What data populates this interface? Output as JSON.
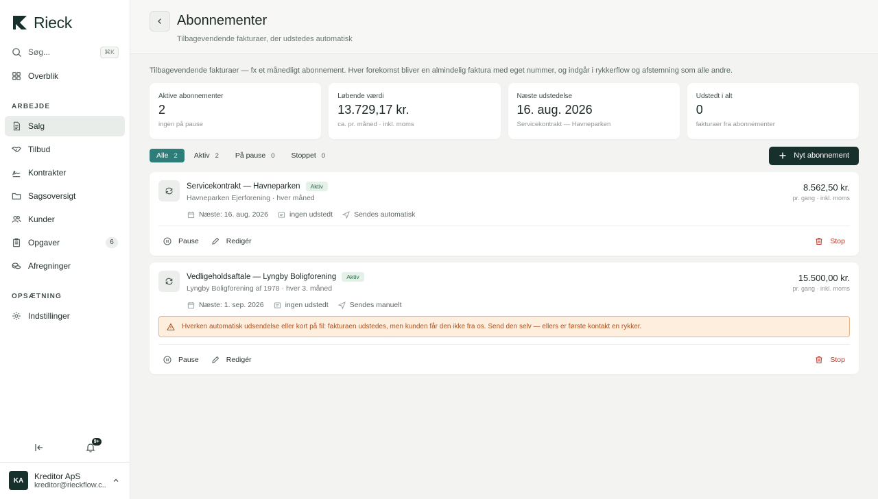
{
  "brand": {
    "name": "Rieck"
  },
  "search": {
    "placeholder": "Søg...",
    "shortcut": "⌘K"
  },
  "nav": {
    "overview": "Overblik",
    "section_work": "ARBEJDE",
    "work_items": [
      {
        "label": "Salg",
        "icon": "document-icon",
        "active": true
      },
      {
        "label": "Tilbud",
        "icon": "handshake-icon"
      },
      {
        "label": "Kontrakter",
        "icon": "signature-icon"
      },
      {
        "label": "Sagsoversigt",
        "icon": "folder-icon"
      },
      {
        "label": "Kunder",
        "icon": "users-icon"
      },
      {
        "label": "Opgaver",
        "icon": "clipboard-icon",
        "badge": "6"
      },
      {
        "label": "Afregninger",
        "icon": "coins-icon"
      }
    ],
    "section_setup": "OPSÆTNING",
    "settings": "Indstillinger"
  },
  "tools": {
    "notif_badge": "9+"
  },
  "account": {
    "initials": "KA",
    "name": "Kreditor ApS",
    "email": "kreditor@rieckflow.c..."
  },
  "header": {
    "title": "Abonnementer",
    "subtitle": "Tilbagevendende fakturaer, der udstedes automatisk"
  },
  "intro": "Tilbagevendende fakturaer — fx et månedligt abonnement. Hver forekomst bliver en almindelig faktura med eget nummer, og indgår i rykkerflow og afstemning som alle andre.",
  "stats": [
    {
      "label": "Aktive abonnementer",
      "value": "2",
      "note": "ingen på pause"
    },
    {
      "label": "Løbende værdi",
      "value": "13.729,17 kr.",
      "note": "ca. pr. måned · inkl. moms"
    },
    {
      "label": "Næste udstedelse",
      "value": "16. aug. 2026",
      "note": "Servicekontrakt — Havneparken"
    },
    {
      "label": "Udstedt i alt",
      "value": "0",
      "note": "fakturaer fra abonnementer"
    }
  ],
  "filters": [
    {
      "label": "Alle",
      "count": "2",
      "active": true
    },
    {
      "label": "Aktiv",
      "count": "2"
    },
    {
      "label": "På pause",
      "count": "0"
    },
    {
      "label": "Stoppet",
      "count": "0"
    }
  ],
  "new_button": "Nyt abonnement",
  "subscriptions": [
    {
      "title": "Servicekontrakt — Havneparken",
      "status": "Aktiv",
      "customer": "Havneparken Ejerforening · hver måned",
      "amount": "8.562,50 kr.",
      "amount_note": "pr. gang · inkl. moms",
      "next": "Næste: 16. aug. 2026",
      "issued": "ingen udstedt",
      "sending": "Sendes automatisk",
      "pause": "Pause",
      "edit": "Redigér",
      "stop": "Stop"
    },
    {
      "title": "Vedligeholdsaftale — Lyngby Boligforening",
      "status": "Aktiv",
      "customer": "Lyngby Boligforening af 1978 · hver 3. måned",
      "amount": "15.500,00 kr.",
      "amount_note": "pr. gang · inkl. moms",
      "next": "Næste: 1. sep. 2026",
      "issued": "ingen udstedt",
      "sending": "Sendes manuelt",
      "warning": "Hverken automatisk udsendelse eller kort på fil: fakturaen udstedes, men kunden får den ikke fra os. Send den selv — ellers er første kontakt en rykker.",
      "pause": "Pause",
      "edit": "Redigér",
      "stop": "Stop"
    }
  ],
  "colors": {
    "accent": "#2e7d78",
    "primary_dark": "#17302b",
    "danger": "#c0392b",
    "warning_bg": "#fdeede"
  }
}
